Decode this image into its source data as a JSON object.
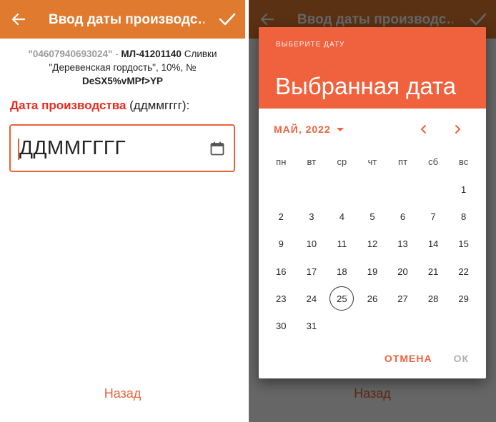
{
  "app": {
    "title": "Ввод даты производс…"
  },
  "product": {
    "barcode": "\"04607940693024\"",
    "separator": " - ",
    "code": "МЛ-41201140",
    "name_part1": " Сливки",
    "name_part2": "\"Деревенская гордость\", 10%, №",
    "serial": "DeSX5%vMPf>YP"
  },
  "field": {
    "label_required": "Дата производства",
    "label_format": " (ддммгггг):",
    "placeholder": "ДДММГГГГ"
  },
  "footer": {
    "back_label": "Назад"
  },
  "dialog": {
    "overline": "ВЫБЕРИТЕ ДАТУ",
    "selected_title": "Выбранная дата",
    "month_label": "МАЙ, 2022",
    "weekdays": [
      "пн",
      "вт",
      "ср",
      "чт",
      "пт",
      "сб",
      "вс"
    ],
    "weeks": [
      [
        "",
        "",
        "",
        "",
        "",
        "",
        "1"
      ],
      [
        "2",
        "3",
        "4",
        "5",
        "6",
        "7",
        "8"
      ],
      [
        "9",
        "10",
        "11",
        "12",
        "13",
        "14",
        "15"
      ],
      [
        "16",
        "17",
        "18",
        "19",
        "20",
        "21",
        "22"
      ],
      [
        "23",
        "24",
        "25",
        "26",
        "27",
        "28",
        "29"
      ],
      [
        "30",
        "31",
        "",
        "",
        "",
        "",
        ""
      ]
    ],
    "today": "25",
    "cancel_label": "ОТМЕНА",
    "ok_label": "ОК"
  },
  "colors": {
    "appbar": "#e07a2e",
    "accent": "#f0623e",
    "required": "#e82a1e"
  },
  "icons": {
    "back": "arrow-left-icon",
    "confirm": "checkmark-icon",
    "calendar": "calendar-icon",
    "prev": "chevron-left-icon",
    "next": "chevron-right-icon",
    "dropdown": "caret-down-icon"
  }
}
